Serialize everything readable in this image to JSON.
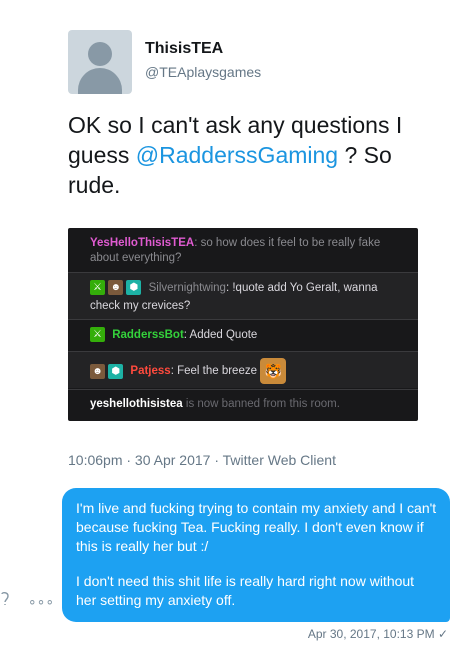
{
  "tweet": {
    "display_name": "ThisisTEA",
    "handle": "@TEAplaysgames",
    "text_before": "OK so I can't ask any questions I guess ",
    "mention": "@RadderssGaming",
    "text_after": " ? So rude.",
    "meta": "10:06pm · 30 Apr 2017 · Twitter Web Client"
  },
  "chat": {
    "line1_user": "YesHelloThisisTEA",
    "line1_user_color": "#e05bd1",
    "line1_text": ": so how does it feel to be really fake about everything?",
    "line2_user": "Silvernightwing",
    "line2_user_color": "#8a8a8f",
    "line2_text": ": !quote add Yo Geralt, wanna check my crevices?",
    "line3_user": "RadderssBot",
    "line3_user_color": "#34d13b",
    "line3_text": ": Added Quote",
    "line4_user": "Patjess",
    "line4_user_color": "#ff4a3d",
    "line4_text": ": Feel the breeze",
    "line5_user": "yeshellothisistea",
    "line5_text": " is now banned from this room."
  },
  "dm": {
    "paragraph1": "I'm live and fucking trying to contain my anxiety and I can't because fucking Tea. Fucking really. I don't even know if this is really her but :/",
    "paragraph2": "I don't need this shit life is really hard right now without her setting my anxiety off.",
    "timestamp": "Apr 30, 2017, 10:13 PM ✓",
    "icon_heart_add": "heart-add-icon",
    "icon_more": "more-icon",
    "more_glyph": "∘∘∘"
  },
  "colors": {
    "accent": "#1da1f2",
    "mention": "#1b95e0"
  }
}
